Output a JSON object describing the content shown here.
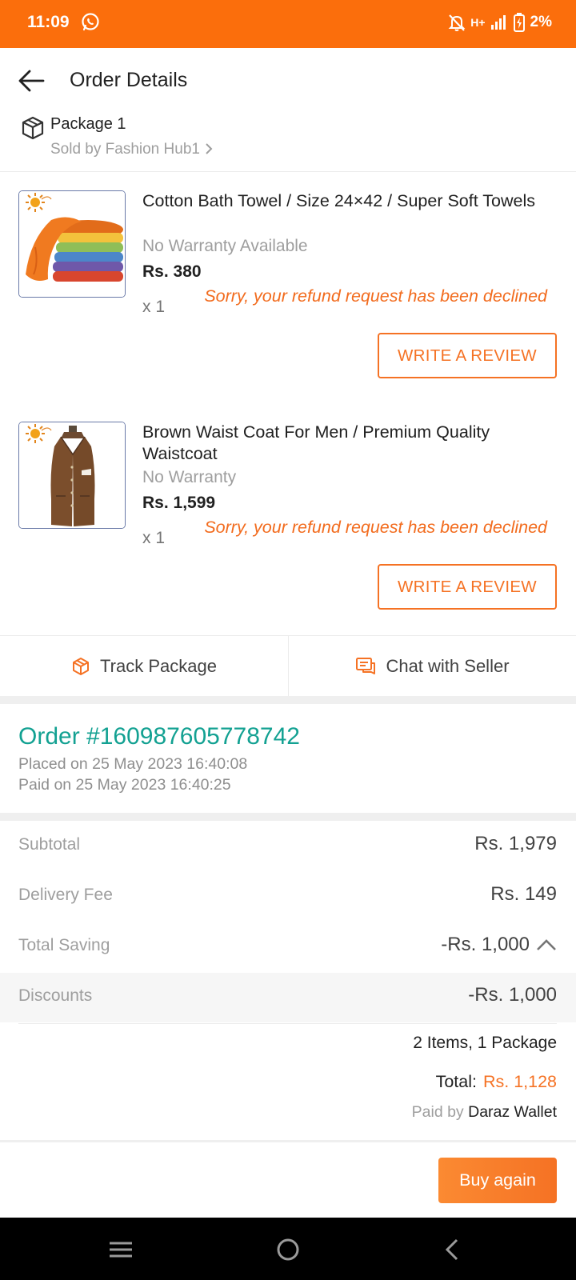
{
  "status_bar": {
    "time": "11:09",
    "network": "H+",
    "battery": "2%",
    "icons": [
      "whatsapp-icon",
      "mute-bell-icon",
      "signal-icon",
      "battery-charging-icon"
    ]
  },
  "header": {
    "title": "Order Details",
    "back_icon": "back-arrow-icon"
  },
  "package": {
    "label": "Package 1",
    "seller": "Sold by Fashion Hub1"
  },
  "items": [
    {
      "title": "Cotton Bath Towel / Size 24×42 / Super Soft Towels",
      "warranty": "No Warranty Available",
      "price": "Rs. 380",
      "qty": "x 1",
      "refund_status": "Sorry, your refund request has been declined",
      "review_label": "WRITE A REVIEW"
    },
    {
      "title": "Brown Waist Coat For Men / Premium Quality Waistcoat",
      "warranty": "No Warranty",
      "price": "Rs. 1,599",
      "qty": "x 1",
      "refund_status": "Sorry, your refund request has been declined",
      "review_label": "WRITE A REVIEW"
    }
  ],
  "actions": {
    "track": "Track Package",
    "chat": "Chat with Seller"
  },
  "order": {
    "number": "Order #160987605778742",
    "placed": "Placed on 25 May 2023  16:40:08",
    "paid": "Paid on 25 May 2023  16:40:25"
  },
  "summary": {
    "subtotal_label": "Subtotal",
    "subtotal_value": "Rs. 1,979",
    "delivery_label": "Delivery Fee",
    "delivery_value": "Rs. 149",
    "saving_label": "Total Saving",
    "saving_value": "-Rs. 1,000",
    "discount_label": "Discounts",
    "discount_value": "-Rs. 1,000",
    "items_count": "2 Items, 1 Package",
    "total_label": "Total:",
    "total_value": "Rs. 1,128",
    "paid_by_label": "Paid by",
    "paid_by_method": "Daraz Wallet"
  },
  "footer": {
    "buy_again": "Buy again"
  },
  "colors": {
    "brand_orange": "#f57224",
    "status_orange": "#fb6e0c",
    "order_teal": "#13a192"
  }
}
